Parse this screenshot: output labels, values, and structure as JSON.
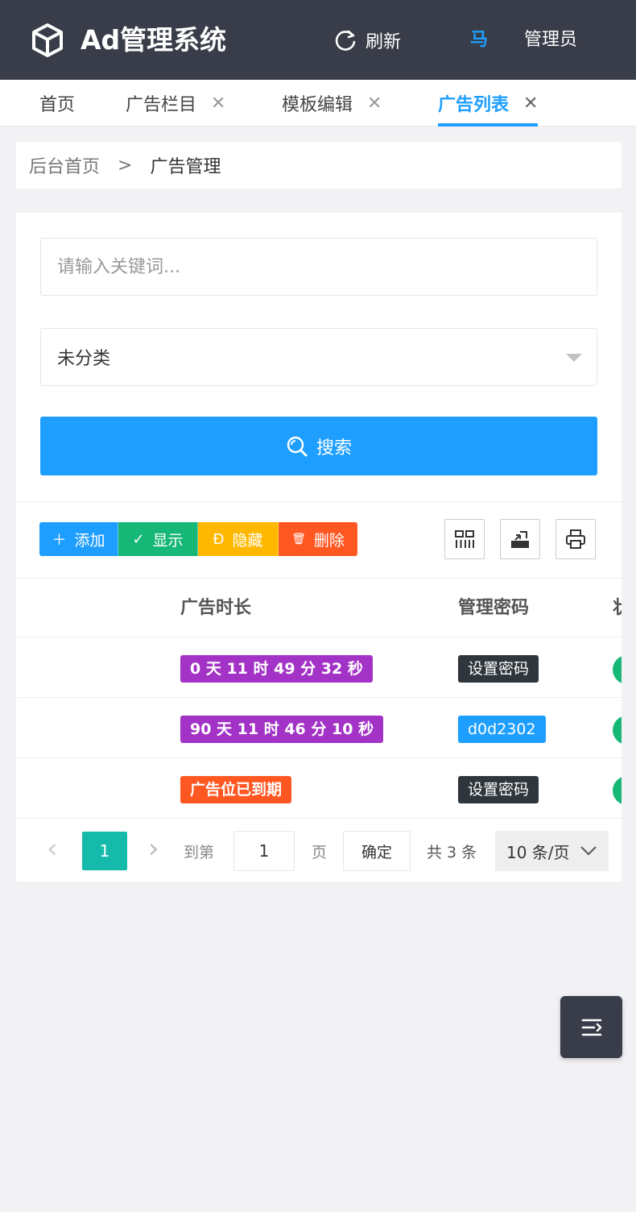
{
  "header": {
    "app_title": "Ad管理系统",
    "refresh_label": "刷新",
    "avatar_text": "马",
    "admin_name": "管理员",
    "logo_icon": "cube-icon",
    "colors": {
      "bar": "#393d49",
      "accent": "#1e9fff"
    }
  },
  "tabs": [
    {
      "label": "首页",
      "closable": false
    },
    {
      "label": "广告栏目",
      "closable": true
    },
    {
      "label": "模板编辑",
      "closable": true
    },
    {
      "label": "广告列表",
      "closable": true,
      "active": true
    }
  ],
  "tab_close_glyph": "✕",
  "breadcrumb": {
    "home": "后台首页",
    "separator": ">",
    "current": "广告管理"
  },
  "search": {
    "placeholder": "请输入关键词...",
    "value": "",
    "category_selected": "未分类",
    "button_label": "搜索"
  },
  "toolbar": {
    "add_label": "添加",
    "show_label": "显示",
    "hide_label": "隐藏",
    "delete_label": "删除",
    "icons": [
      "columns-icon",
      "export-icon",
      "print-icon"
    ],
    "colors": {
      "add": "#1e9fff",
      "show": "#16b777",
      "hide": "#ffb800",
      "delete": "#ff5722"
    }
  },
  "table": {
    "columns": [
      "广告时长",
      "管理密码",
      "状"
    ],
    "rows": [
      {
        "duration": "0 天 11 时 49 分 32 秒",
        "duration_color": "#a233c6",
        "password": "设置密码",
        "password_color": "#2f363c"
      },
      {
        "duration": "90 天 11 时 46 分 10 秒",
        "duration_color": "#a233c6",
        "password": "d0d2302",
        "password_color": "#1e9fff"
      },
      {
        "duration": "广告位已到期",
        "duration_color": "#ff5722",
        "password": "设置密码",
        "password_color": "#2f363c"
      }
    ]
  },
  "pagination": {
    "prev": "‹",
    "current_page": "1",
    "next": "›",
    "goto_label": "到第",
    "goto_value": "1",
    "page_label": "页",
    "confirm_label": "确定",
    "total": "共 3 条",
    "page_size": "10 条/页"
  },
  "fab_icon": "menu-collapse-icon"
}
